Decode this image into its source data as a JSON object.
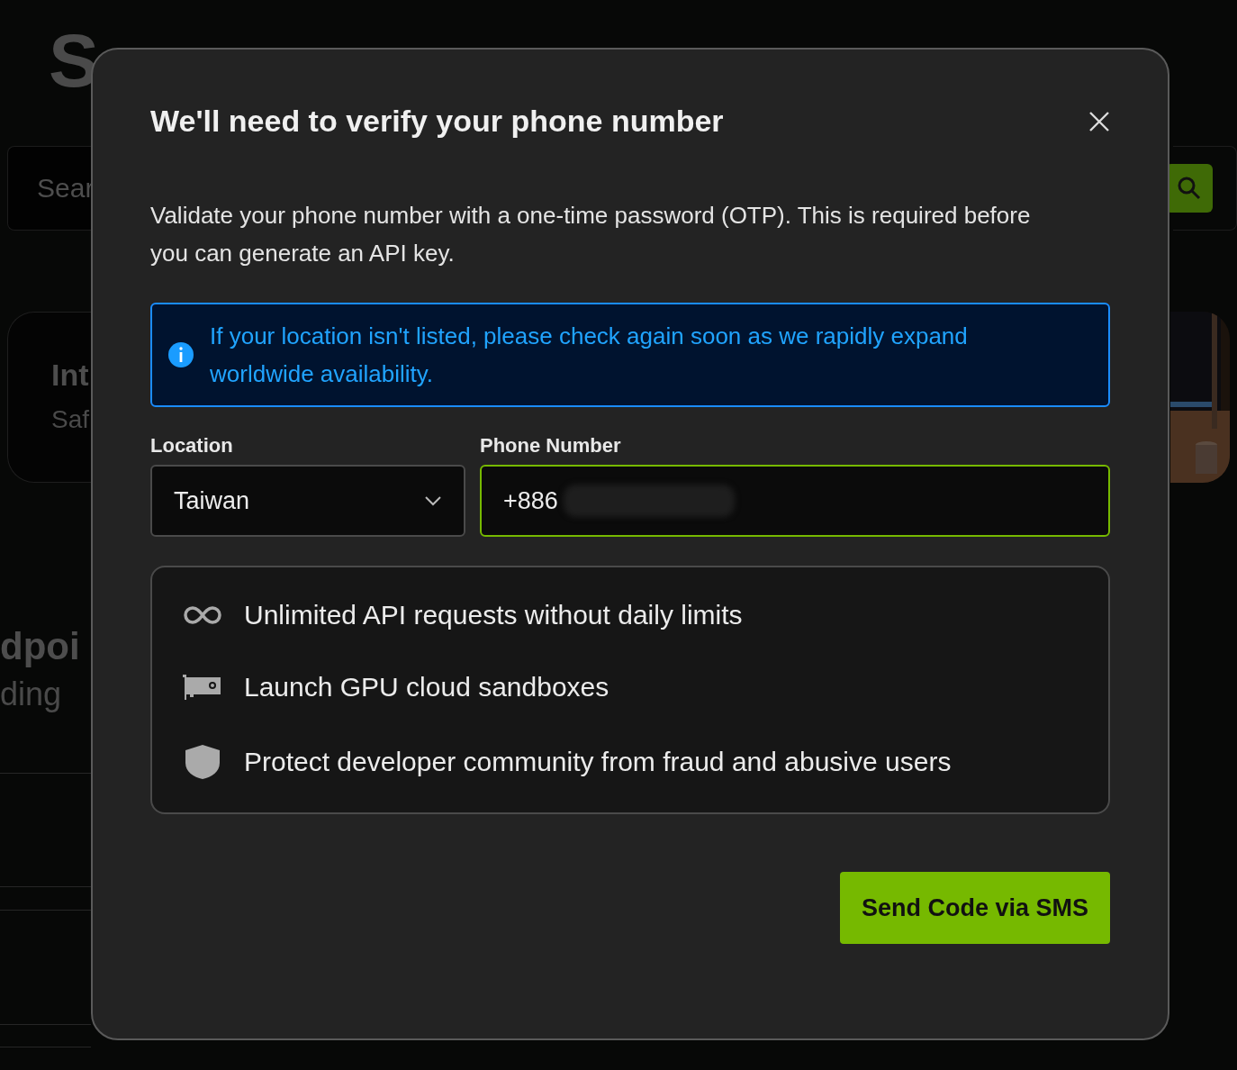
{
  "background": {
    "title_fragment": "S",
    "search_placeholder": "Sear",
    "card_title": "Int",
    "card_subtitle": "Saf",
    "section_title": "dpoi",
    "section_subtitle": "ding"
  },
  "dialog": {
    "title": "We'll need to verify your phone number",
    "description": "Validate your phone number with a one-time password (OTP). This is required before you can generate an API key.",
    "notice": "If your location isn't listed, please check again soon as we rapidly expand worldwide availability.",
    "fields": [
      {
        "kind": "select",
        "label": "Location",
        "value": "Taiwan",
        "focused": false
      },
      {
        "kind": "input",
        "label": "Phone Number",
        "value": "+886",
        "focused": true
      }
    ],
    "benefits": [
      {
        "kind": "infinity",
        "text": "Unlimited API requests without daily limits"
      },
      {
        "kind": "gpu",
        "text": "Launch GPU cloud sandboxes"
      },
      {
        "kind": "shield",
        "text": "Protect developer community from fraud and abusive users"
      }
    ],
    "submit": "Send Code via SMS"
  }
}
